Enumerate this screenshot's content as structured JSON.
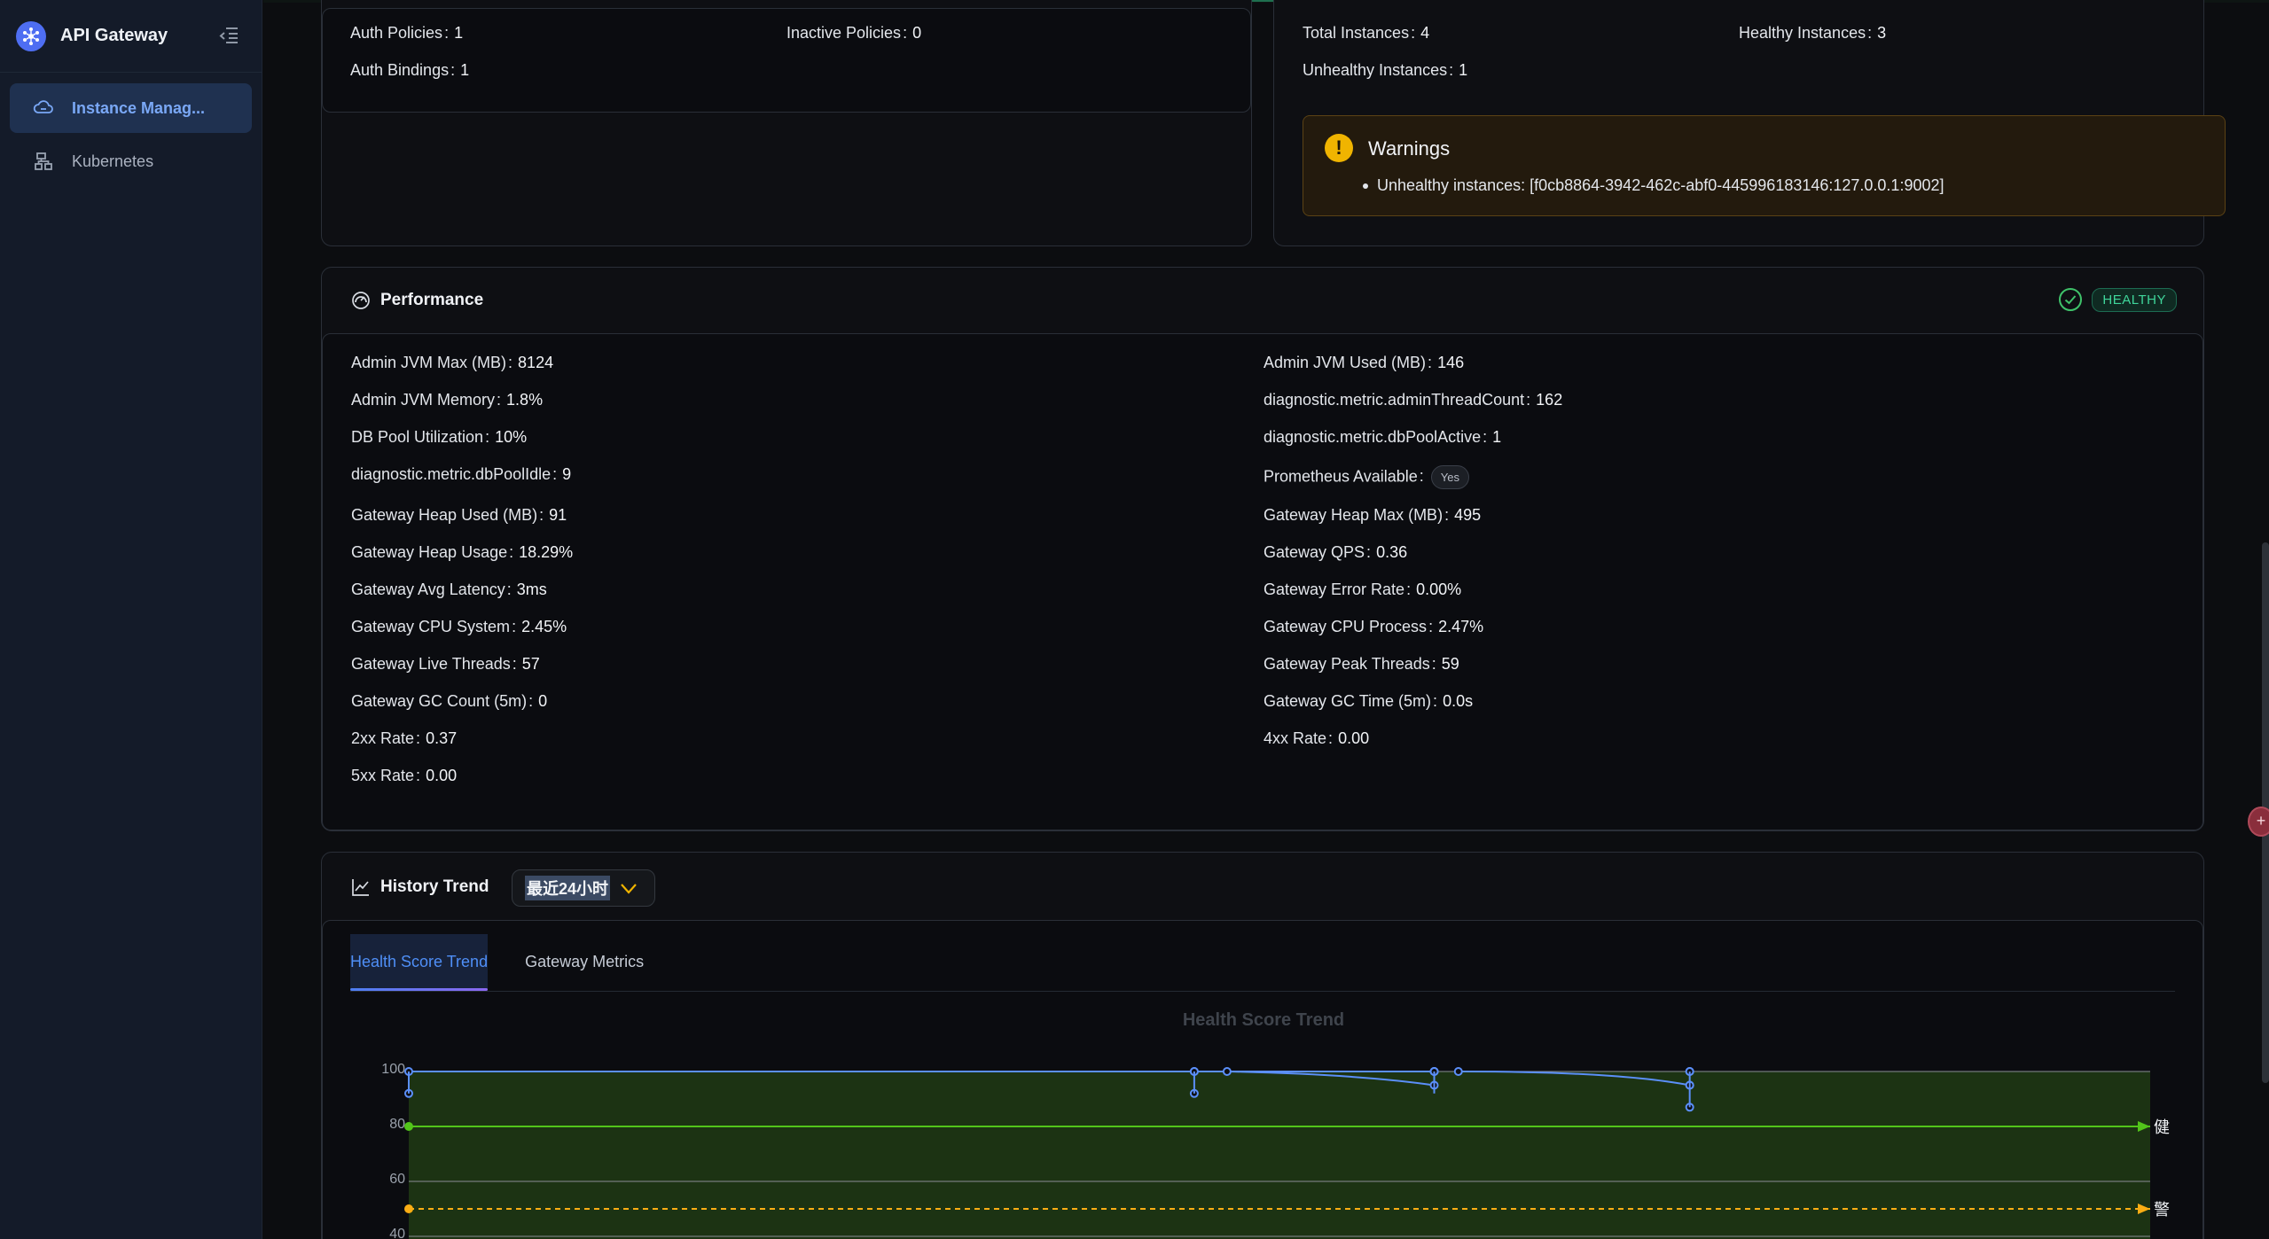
{
  "app": {
    "title": "API Gateway"
  },
  "sidebar": {
    "items": [
      {
        "label": "Instance Manag...",
        "icon": "cloud-icon",
        "active": true
      },
      {
        "label": "Kubernetes",
        "icon": "cluster-icon",
        "active": false
      }
    ]
  },
  "auth": {
    "policies_label": "Auth Policies",
    "policies_value": "1",
    "inactive_label": "Inactive Policies",
    "inactive_value": "0",
    "bindings_label": "Auth Bindings",
    "bindings_value": "1"
  },
  "instances": {
    "total_label": "Total Instances",
    "total_value": "4",
    "healthy_label": "Healthy Instances",
    "healthy_value": "3",
    "unhealthy_label": "Unhealthy Instances",
    "unhealthy_value": "1",
    "warnings_title": "Warnings",
    "warning_item": "Unhealthy instances: [f0cb8864-3942-462c-abf0-445996183146:127.0.0.1:9002]"
  },
  "performance": {
    "title": "Performance",
    "status": "HEALTHY",
    "left": [
      {
        "label": "Admin JVM Max (MB)",
        "value": "8124"
      },
      {
        "label": "Admin JVM Memory",
        "value": "1.8%"
      },
      {
        "label": "DB Pool Utilization",
        "value": "10%"
      },
      {
        "label": "diagnostic.metric.dbPoolIdle",
        "value": "9"
      },
      {
        "label": "Gateway Heap Used (MB)",
        "value": "91"
      },
      {
        "label": "Gateway Heap Usage",
        "value": "18.29%"
      },
      {
        "label": "Gateway Avg Latency",
        "value": "3ms"
      },
      {
        "label": "Gateway CPU System",
        "value": "2.45%"
      },
      {
        "label": "Gateway Live Threads",
        "value": "57"
      },
      {
        "label": "Gateway GC Count (5m)",
        "value": "0"
      },
      {
        "label": "2xx Rate",
        "value": "0.37"
      },
      {
        "label": "5xx Rate",
        "value": "0.00"
      }
    ],
    "right": [
      {
        "label": "Admin JVM Used (MB)",
        "value": "146"
      },
      {
        "label": "diagnostic.metric.adminThreadCount",
        "value": "162"
      },
      {
        "label": "diagnostic.metric.dbPoolActive",
        "value": "1"
      },
      {
        "label": "Prometheus Available",
        "value": "Yes"
      },
      {
        "label": "Gateway Heap Max (MB)",
        "value": "495"
      },
      {
        "label": "Gateway QPS",
        "value": "0.36"
      },
      {
        "label": "Gateway Error Rate",
        "value": "0.00%"
      },
      {
        "label": "Gateway CPU Process",
        "value": "2.47%"
      },
      {
        "label": "Gateway Peak Threads",
        "value": "59"
      },
      {
        "label": "Gateway GC Time (5m)",
        "value": "0.0s"
      },
      {
        "label": "4xx Rate",
        "value": "0.00"
      }
    ]
  },
  "history": {
    "title": "History Trend",
    "range": "最近24小时",
    "tabs": [
      "Health Score Trend",
      "Gateway Metrics"
    ],
    "active_tab": 0
  },
  "chart_data": {
    "type": "line",
    "title": "Health Score Trend",
    "ylim": [
      40,
      100
    ],
    "yticks": [
      "100",
      "80",
      "60",
      "40"
    ],
    "series": [
      {
        "values": [
          100,
          92,
          100,
          100,
          92,
          100,
          100,
          95,
          100,
          100,
          100,
          95,
          100,
          100,
          95,
          87
        ]
      }
    ],
    "thresholds": [
      {
        "value": 80,
        "label": "健",
        "color": "#52c41a"
      },
      {
        "value": 50,
        "label": "警",
        "color": "#faad14"
      }
    ],
    "colors": {
      "line": "#5b8ff9",
      "area": "#1c3313"
    }
  },
  "float_button": {
    "label": "+"
  }
}
